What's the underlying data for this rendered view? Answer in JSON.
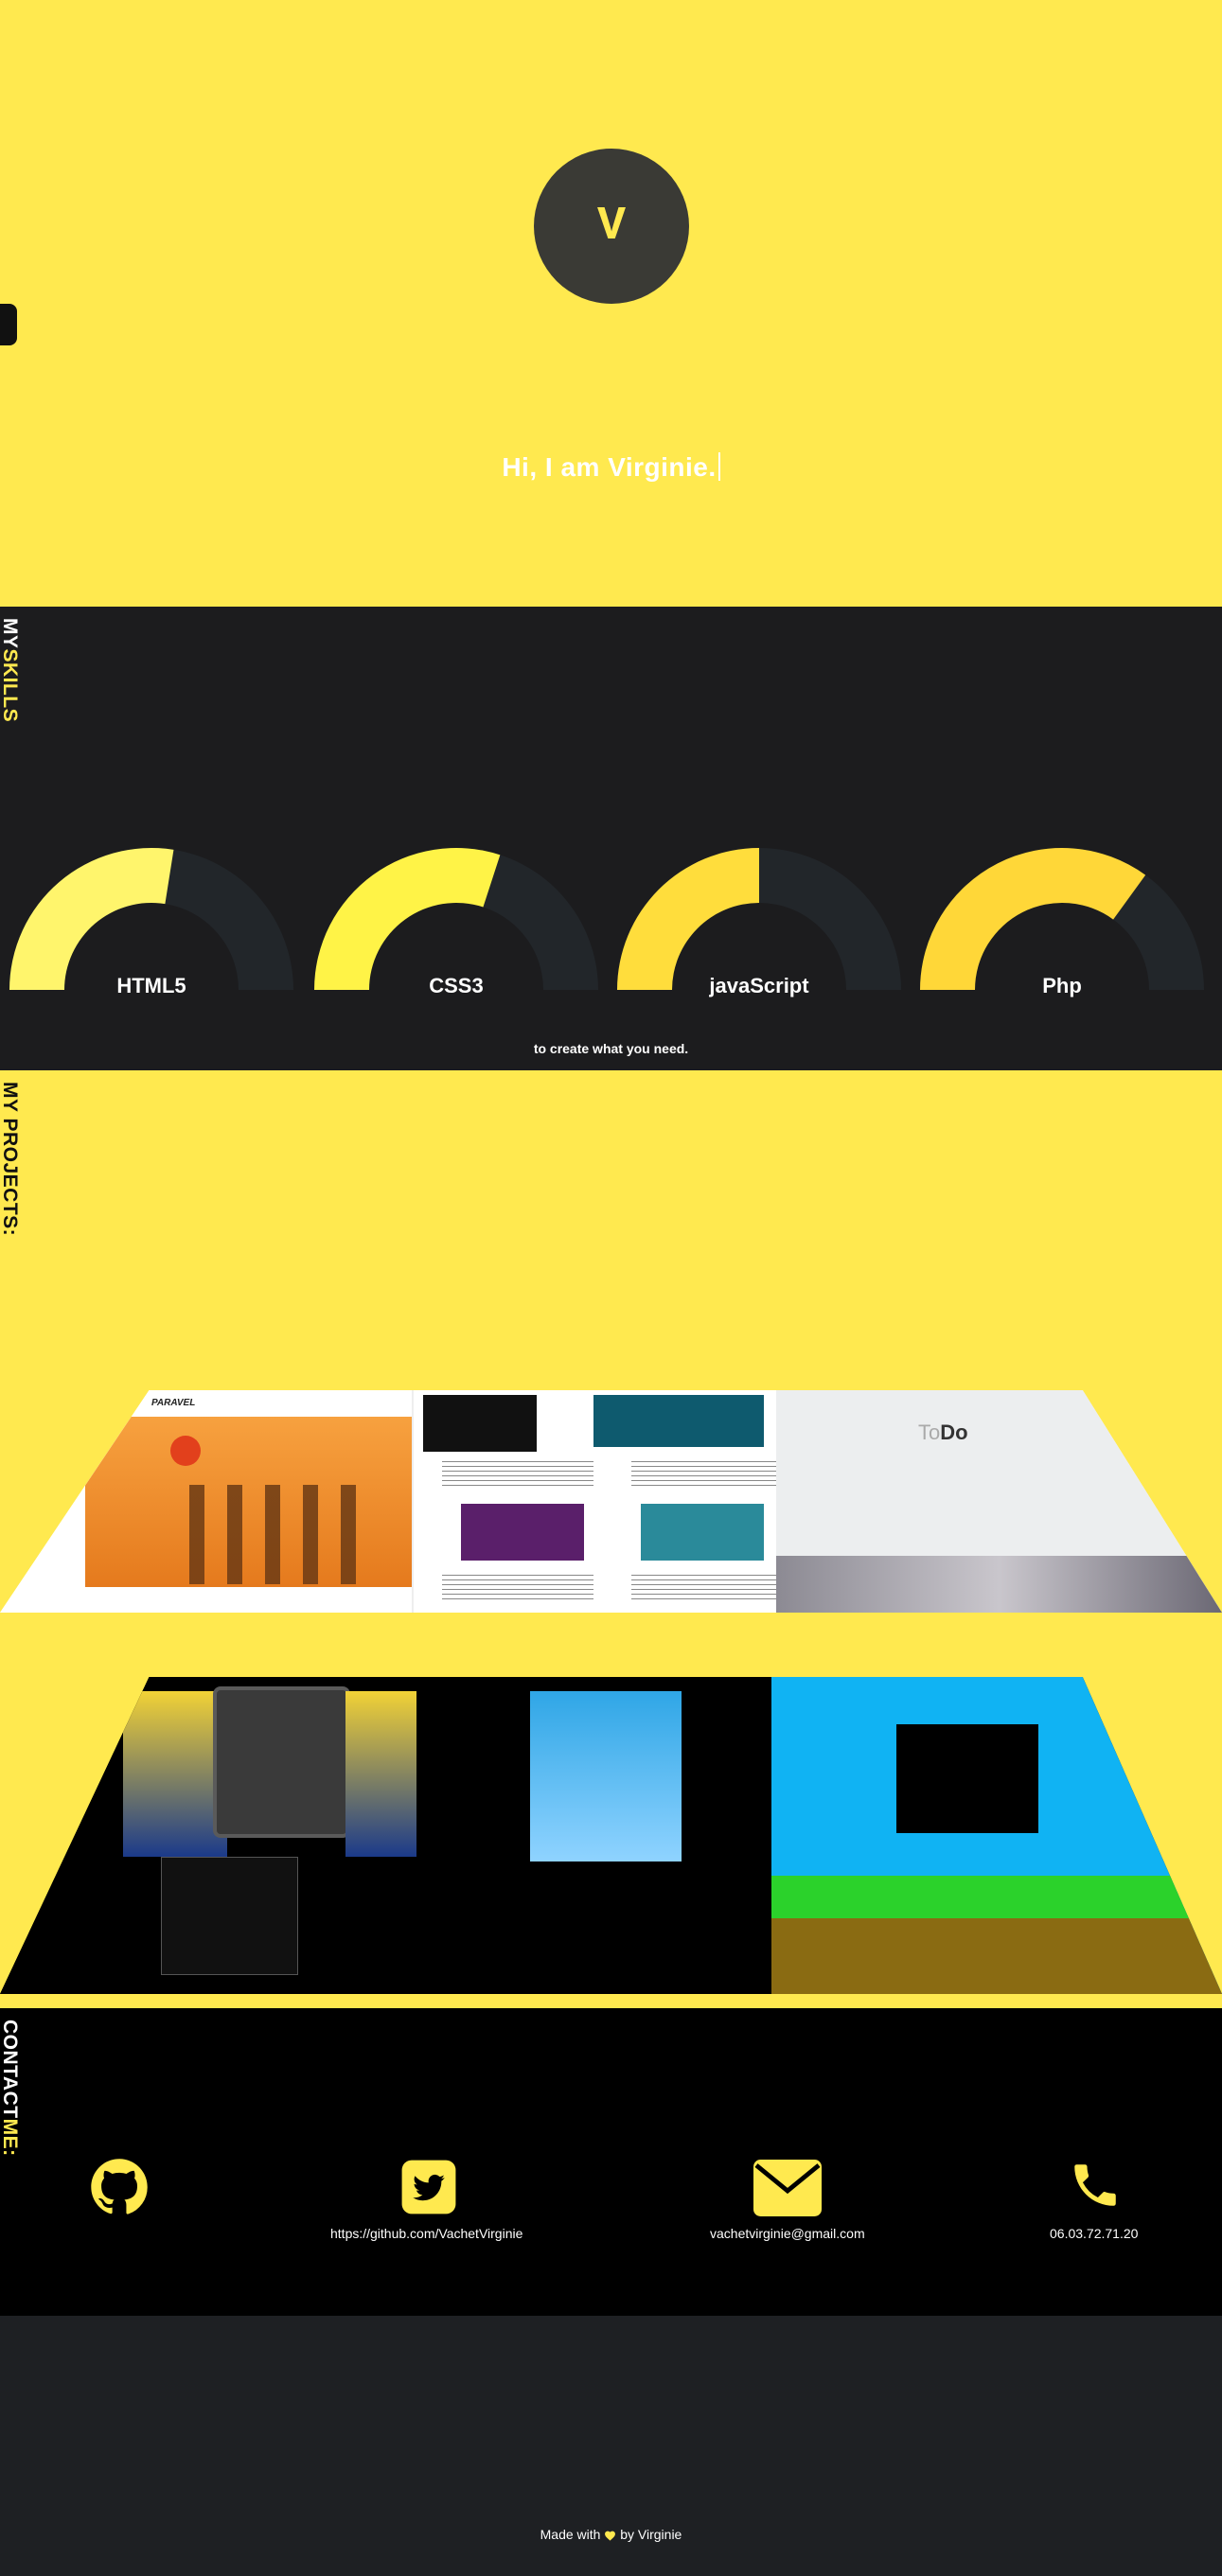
{
  "hero": {
    "logo_letter": "V",
    "greeting": "Hi, I am Virginie."
  },
  "skills": {
    "title_part1": "MY",
    "title_part2": "SKILLS",
    "items": [
      {
        "label": "HTML5",
        "level": 0.55
      },
      {
        "label": "CSS3",
        "level": 0.6
      },
      {
        "label": "javaScript",
        "level": 0.5
      },
      {
        "label": "Php",
        "level": 0.7
      }
    ],
    "tagline": "to create what you need."
  },
  "projects": {
    "title": "MY PROJECTS:",
    "site1_brand": "PARAVEL",
    "site3_title_a": "To",
    "site3_title_b": "Do"
  },
  "contact": {
    "title_part1": "CONTACT",
    "title_part2": "ME:",
    "github_url": "https://github.com/VachetVirginie",
    "email": "vachetvirginie@gmail.com",
    "phone": "06.03.72.71.20"
  },
  "footer": {
    "made_with": "Made with",
    "by": "by Virginie"
  },
  "colors": {
    "accent": "#ffe94f",
    "dark": "#1c1c1e",
    "gauge_track": "#22262a"
  }
}
